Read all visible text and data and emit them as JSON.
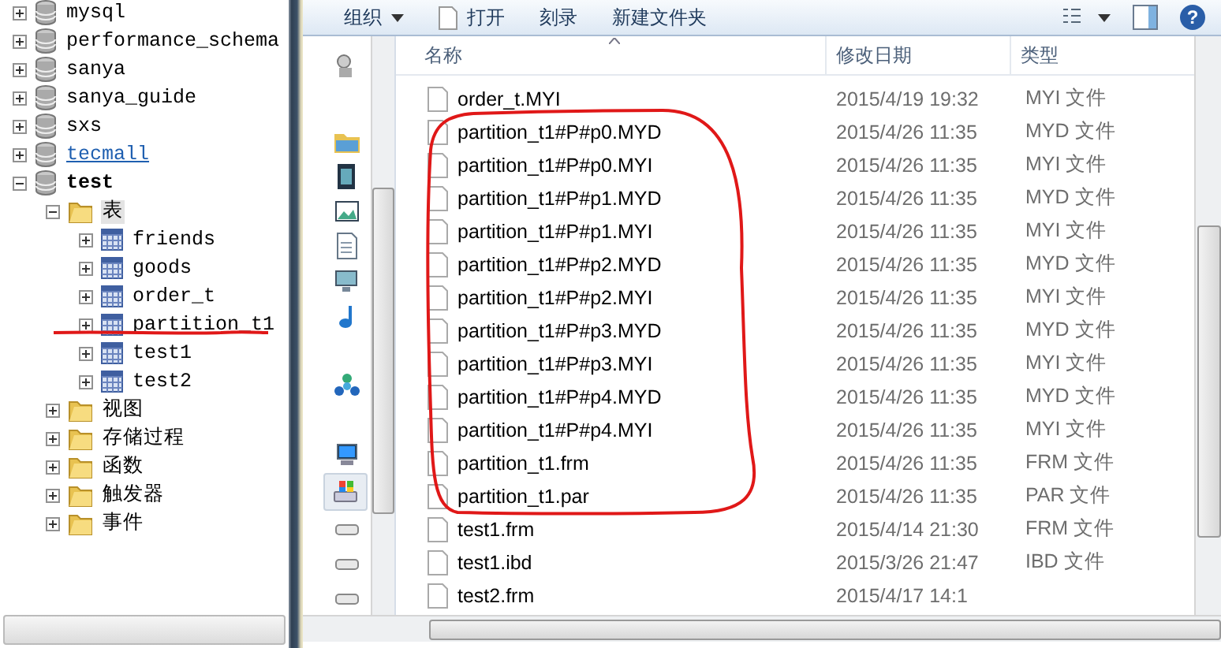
{
  "tree": {
    "items": [
      {
        "label": "mysql",
        "kind": "database",
        "expanded": false,
        "current": false,
        "hovered": false
      },
      {
        "label": "performance_schema",
        "kind": "database",
        "expanded": false,
        "current": false,
        "hovered": false
      },
      {
        "label": "sanya",
        "kind": "database",
        "expanded": false,
        "current": false,
        "hovered": false
      },
      {
        "label": "sanya_guide",
        "kind": "database",
        "expanded": false,
        "current": false,
        "hovered": false
      },
      {
        "label": "sxs",
        "kind": "database",
        "expanded": false,
        "current": false,
        "hovered": false
      },
      {
        "label": "tecmall",
        "kind": "database",
        "expanded": false,
        "current": false,
        "hovered": true
      },
      {
        "label": "test",
        "kind": "database",
        "expanded": true,
        "current": true,
        "hovered": false,
        "children": [
          {
            "label": "表",
            "kind": "folder",
            "expanded": true,
            "selected": true,
            "children": [
              {
                "label": "friends",
                "kind": "table",
                "expanded": false,
                "selected": false
              },
              {
                "label": "goods",
                "kind": "table",
                "expanded": false,
                "selected": false
              },
              {
                "label": "order_t",
                "kind": "table",
                "expanded": false,
                "selected": false
              },
              {
                "label": "partition_t1",
                "kind": "table",
                "expanded": false,
                "selected": false
              },
              {
                "label": "test1",
                "kind": "table",
                "expanded": false,
                "selected": false
              },
              {
                "label": "test2",
                "kind": "table",
                "expanded": false,
                "selected": false
              }
            ]
          },
          {
            "label": "视图",
            "kind": "folder",
            "expanded": false,
            "selected": false
          },
          {
            "label": "存储过程",
            "kind": "folder",
            "expanded": false,
            "selected": false
          },
          {
            "label": "函数",
            "kind": "folder",
            "expanded": false,
            "selected": false
          },
          {
            "label": "触发器",
            "kind": "folder",
            "expanded": false,
            "selected": false
          },
          {
            "label": "事件",
            "kind": "folder",
            "expanded": false,
            "selected": false
          }
        ]
      }
    ]
  },
  "toolbar": {
    "buttons": [
      {
        "label": "组织",
        "kind": "menu"
      },
      {
        "label": "打开",
        "kind": "open"
      },
      {
        "label": "刻录",
        "kind": "plain"
      },
      {
        "label": "新建文件夹",
        "kind": "plain"
      }
    ],
    "help": "?"
  },
  "navigation_pane": {
    "items": [
      {
        "kind": "library",
        "selected": false
      },
      {
        "kind": "folder",
        "selected": false
      },
      {
        "kind": "video",
        "selected": false
      },
      {
        "kind": "image",
        "selected": false
      },
      {
        "kind": "document",
        "selected": false
      },
      {
        "kind": "monitor",
        "selected": false
      },
      {
        "kind": "music",
        "selected": false
      },
      {
        "kind": "network",
        "selected": false
      },
      {
        "kind": "computer",
        "selected": false
      },
      {
        "kind": "system-drive",
        "selected": true
      },
      {
        "kind": "drive",
        "selected": false
      },
      {
        "kind": "drive",
        "selected": false
      },
      {
        "kind": "drive",
        "selected": false
      }
    ]
  },
  "file_list": {
    "columns": [
      "名称",
      "修改日期",
      "类型"
    ],
    "rows": [
      {
        "name": "order_t.MYI",
        "modified": "2015/4/19 19:32",
        "type": "MYI 文件"
      },
      {
        "name": "partition_t1#P#p0.MYD",
        "modified": "2015/4/26 11:35",
        "type": "MYD 文件"
      },
      {
        "name": "partition_t1#P#p0.MYI",
        "modified": "2015/4/26 11:35",
        "type": "MYI 文件"
      },
      {
        "name": "partition_t1#P#p1.MYD",
        "modified": "2015/4/26 11:35",
        "type": "MYD 文件"
      },
      {
        "name": "partition_t1#P#p1.MYI",
        "modified": "2015/4/26 11:35",
        "type": "MYI 文件"
      },
      {
        "name": "partition_t1#P#p2.MYD",
        "modified": "2015/4/26 11:35",
        "type": "MYD 文件"
      },
      {
        "name": "partition_t1#P#p2.MYI",
        "modified": "2015/4/26 11:35",
        "type": "MYI 文件"
      },
      {
        "name": "partition_t1#P#p3.MYD",
        "modified": "2015/4/26 11:35",
        "type": "MYD 文件"
      },
      {
        "name": "partition_t1#P#p3.MYI",
        "modified": "2015/4/26 11:35",
        "type": "MYI 文件"
      },
      {
        "name": "partition_t1#P#p4.MYD",
        "modified": "2015/4/26 11:35",
        "type": "MYD 文件"
      },
      {
        "name": "partition_t1#P#p4.MYI",
        "modified": "2015/4/26 11:35",
        "type": "MYI 文件"
      },
      {
        "name": "partition_t1.frm",
        "modified": "2015/4/26 11:35",
        "type": "FRM 文件"
      },
      {
        "name": "partition_t1.par",
        "modified": "2015/4/26 11:35",
        "type": "PAR 文件"
      },
      {
        "name": "test1.frm",
        "modified": "2015/4/14 21:30",
        "type": "FRM 文件"
      },
      {
        "name": "test1.ibd",
        "modified": "2015/3/26 21:47",
        "type": "IBD 文件"
      },
      {
        "name": "test2.frm",
        "modified": "2015/4/17 14:1"
      }
    ]
  }
}
